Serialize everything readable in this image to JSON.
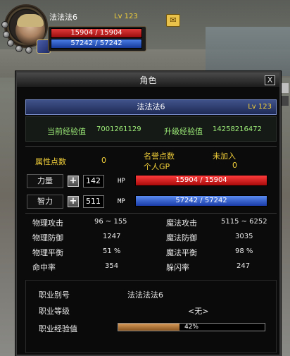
{
  "hud": {
    "name": "法法法6",
    "level": "Lv 123",
    "hp": "15904 / 15904",
    "mp": "57242 / 57242"
  },
  "panel": {
    "title": "角色",
    "close_label": "X",
    "char_name": "法法法6",
    "char_level": "Lv 123",
    "current_exp_label": "当前经验值",
    "current_exp": "7001261129",
    "next_exp_label": "升级经验值",
    "next_exp": "14258216472",
    "attr_points_label": "属性点数",
    "attr_points": "0",
    "fame_points_label": "名誉点数",
    "fame_status": "未加入",
    "personal_gp_label": "个人GP",
    "personal_gp": "0",
    "str_label": "力量",
    "str_value": "142",
    "hp_tag": "HP",
    "hp_bar": "15904 / 15904",
    "int_label": "智力",
    "int_value": "511",
    "mp_tag": "MP",
    "mp_bar": "57242 / 57242",
    "stats_left": [
      {
        "label": "物理攻击",
        "value": "96 ~ 155"
      },
      {
        "label": "物理防御",
        "value": "1247"
      },
      {
        "label": "物理平衡",
        "value": "51 %"
      },
      {
        "label": "命中率",
        "value": "354"
      }
    ],
    "stats_right": [
      {
        "label": "魔法攻击",
        "value": "5115 ~ 6252"
      },
      {
        "label": "魔法防御",
        "value": "3035"
      },
      {
        "label": "魔法平衡",
        "value": "98 %"
      },
      {
        "label": "躲闪率",
        "value": "247"
      }
    ],
    "job_alias_label": "职业别号",
    "job_alias": "法法法法6",
    "job_level_label": "职业等级",
    "job_level": "<无>",
    "job_exp_label": "职业经验值",
    "job_exp_percent": "42%",
    "job_exp_fraction": 0.42
  },
  "colors": {
    "hp": "#c01818",
    "mp": "#2a56c8",
    "name_bar": "#2f3f72",
    "gold": "#f5d23a",
    "green": "#9ff07a"
  }
}
